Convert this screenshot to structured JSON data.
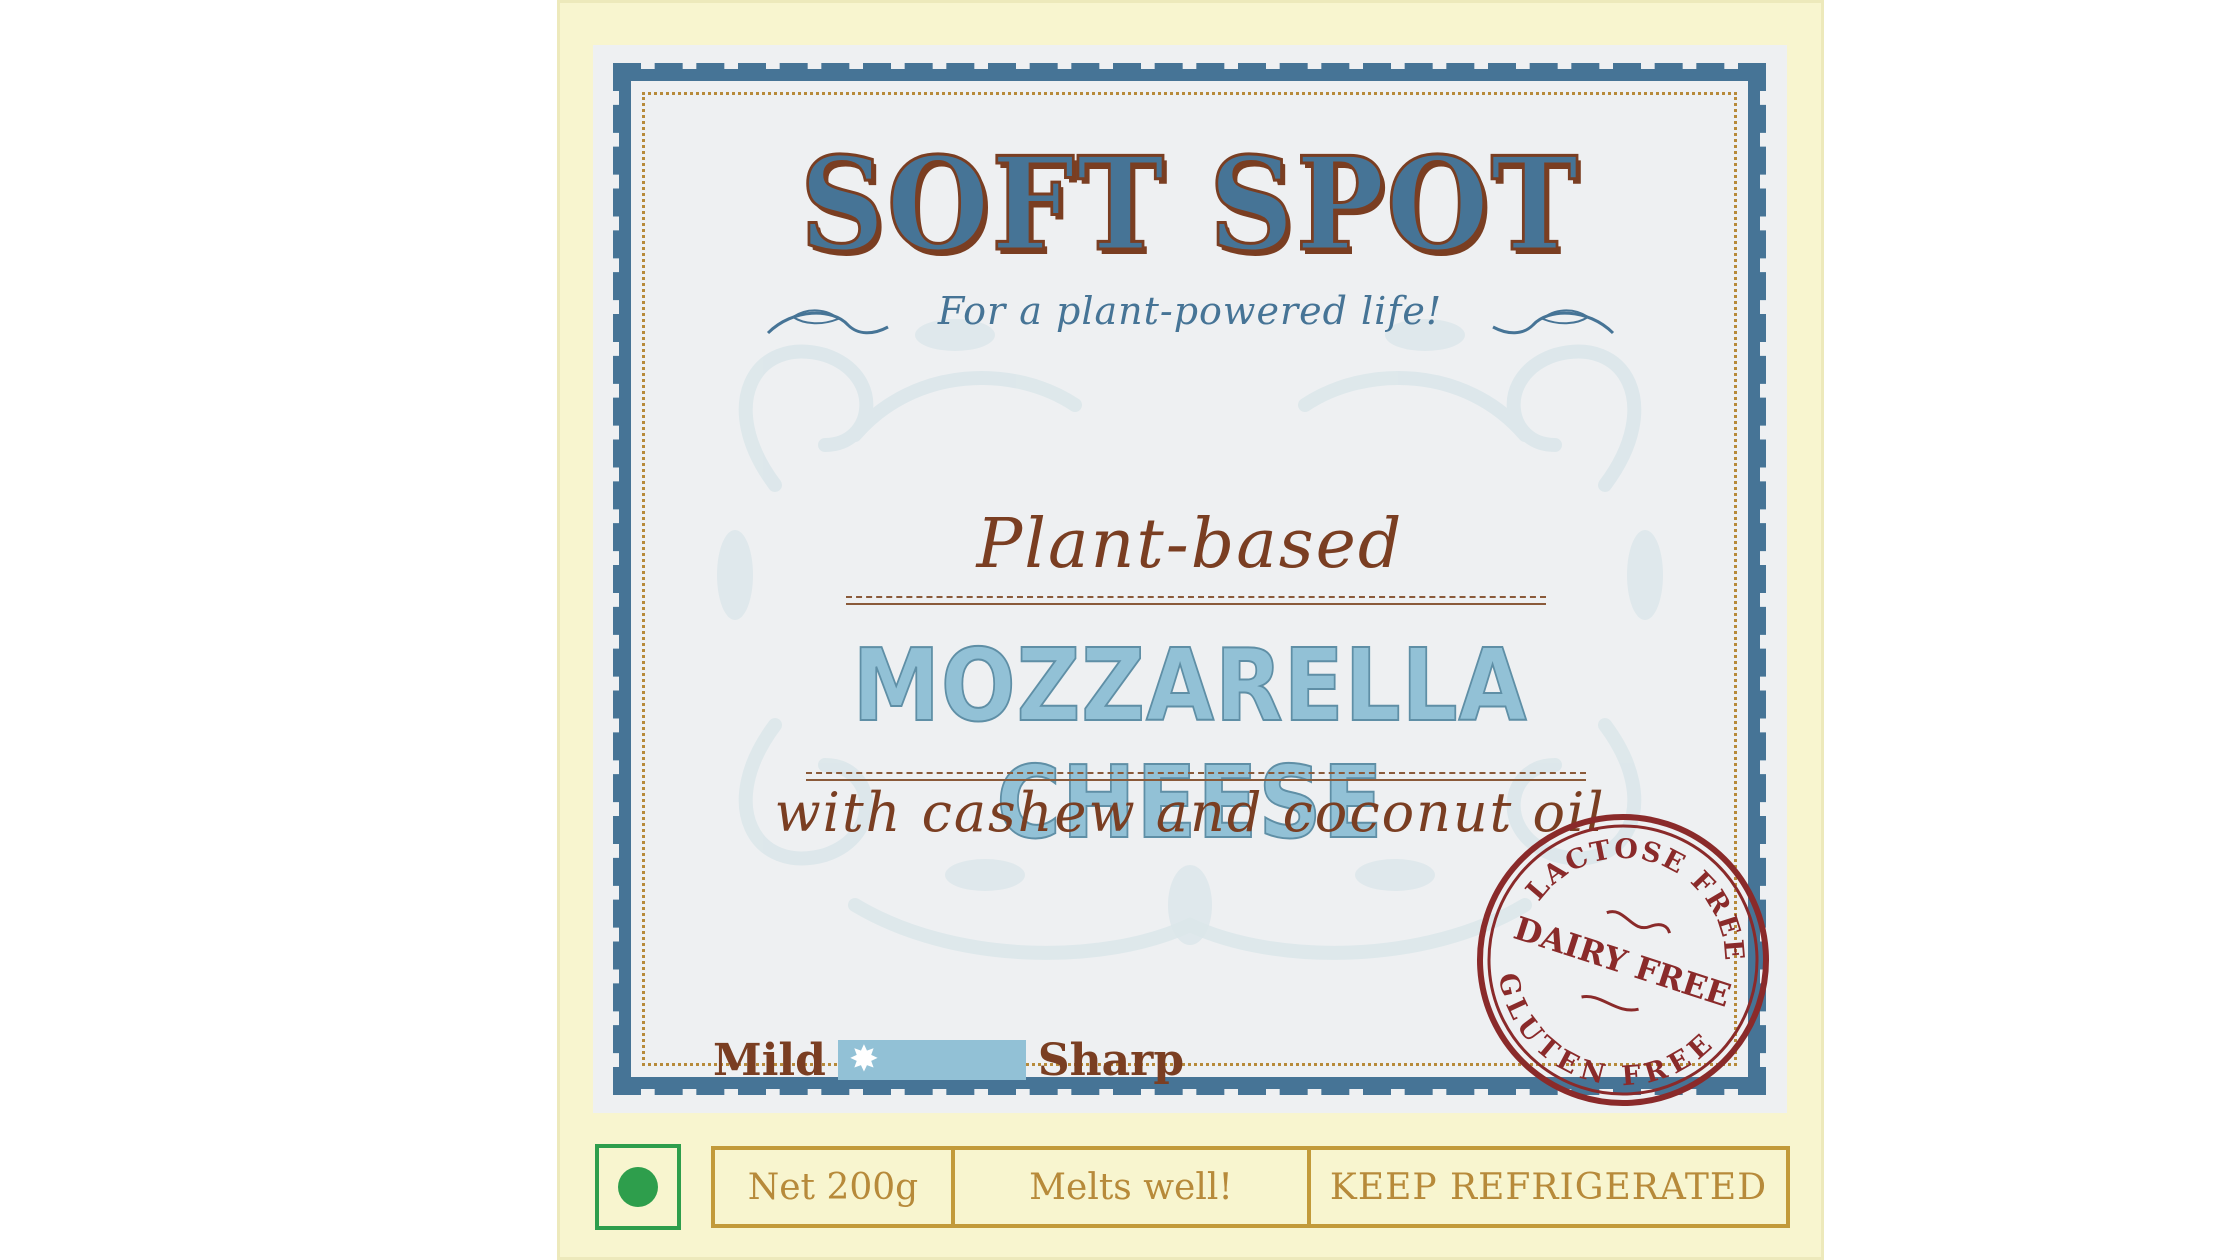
{
  "label": {
    "brand": "SOFT SPOT",
    "tagline": "For a plant-powered life!",
    "descriptor": "Plant-based",
    "product": "MOZZARELLA CHEESE",
    "ingredients": "with cashew and coconut oil"
  },
  "strength_scale": {
    "min_label": "Mild",
    "max_label": "Sharp",
    "level": 0.0
  },
  "seal": {
    "top_text": "LACTOSE FREE",
    "middle_text": "DAIRY FREE",
    "bottom_text": "GLUTEN FREE"
  },
  "footer": {
    "veg_mark": "veg-symbol-icon",
    "net_weight": "Net 200g",
    "feature": "Melts well!",
    "storage": "KEEP REFRIGERATED"
  },
  "colors": {
    "box_cream": "#f8f5cf",
    "frame_blue": "#467496",
    "brand_brown": "#7a3e22",
    "light_blue": "#92c1d6",
    "gold": "#c29a3a",
    "veg_green": "#2e9e4c"
  }
}
